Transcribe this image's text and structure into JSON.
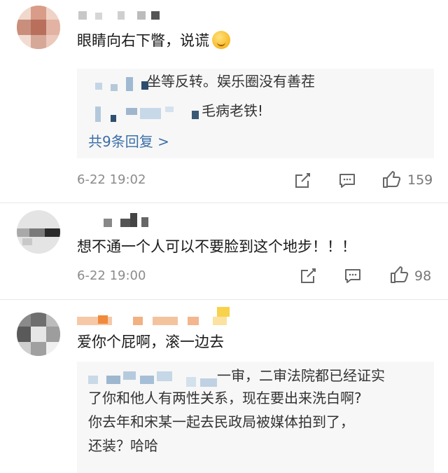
{
  "comments": [
    {
      "text": "眼睛向右下瞥，说谎",
      "emoji": "smiling-face-with-hand-over-mouth",
      "replies": [
        {
          "text": "坐等反转。娱乐圈没有善茬"
        },
        {
          "text": "毛病老铁!"
        }
      ],
      "more_replies": "共9条回复 >",
      "time": "6-22 19:02",
      "likes": "159"
    },
    {
      "text": "想不通一个人可以不要脸到这个地步！！！",
      "time": "6-22 19:00",
      "likes": "98"
    },
    {
      "text": "爱你个屁啊，滚一边去",
      "reply_lines": [
        "一审，二审法院都已经证实",
        "了你和他人有两性关系，现在要出来洗白啊?",
        "你去年和宋某一起去民政局被媒体拍到了，",
        "还装？哈哈"
      ]
    }
  ],
  "icons": {
    "share": "share-icon",
    "comment": "comment-icon",
    "like": "thumbs-up-icon"
  },
  "colors": {
    "link": "#3b6fa8",
    "meta": "#8c8c8c",
    "reply_bg": "#f7f7f7"
  }
}
